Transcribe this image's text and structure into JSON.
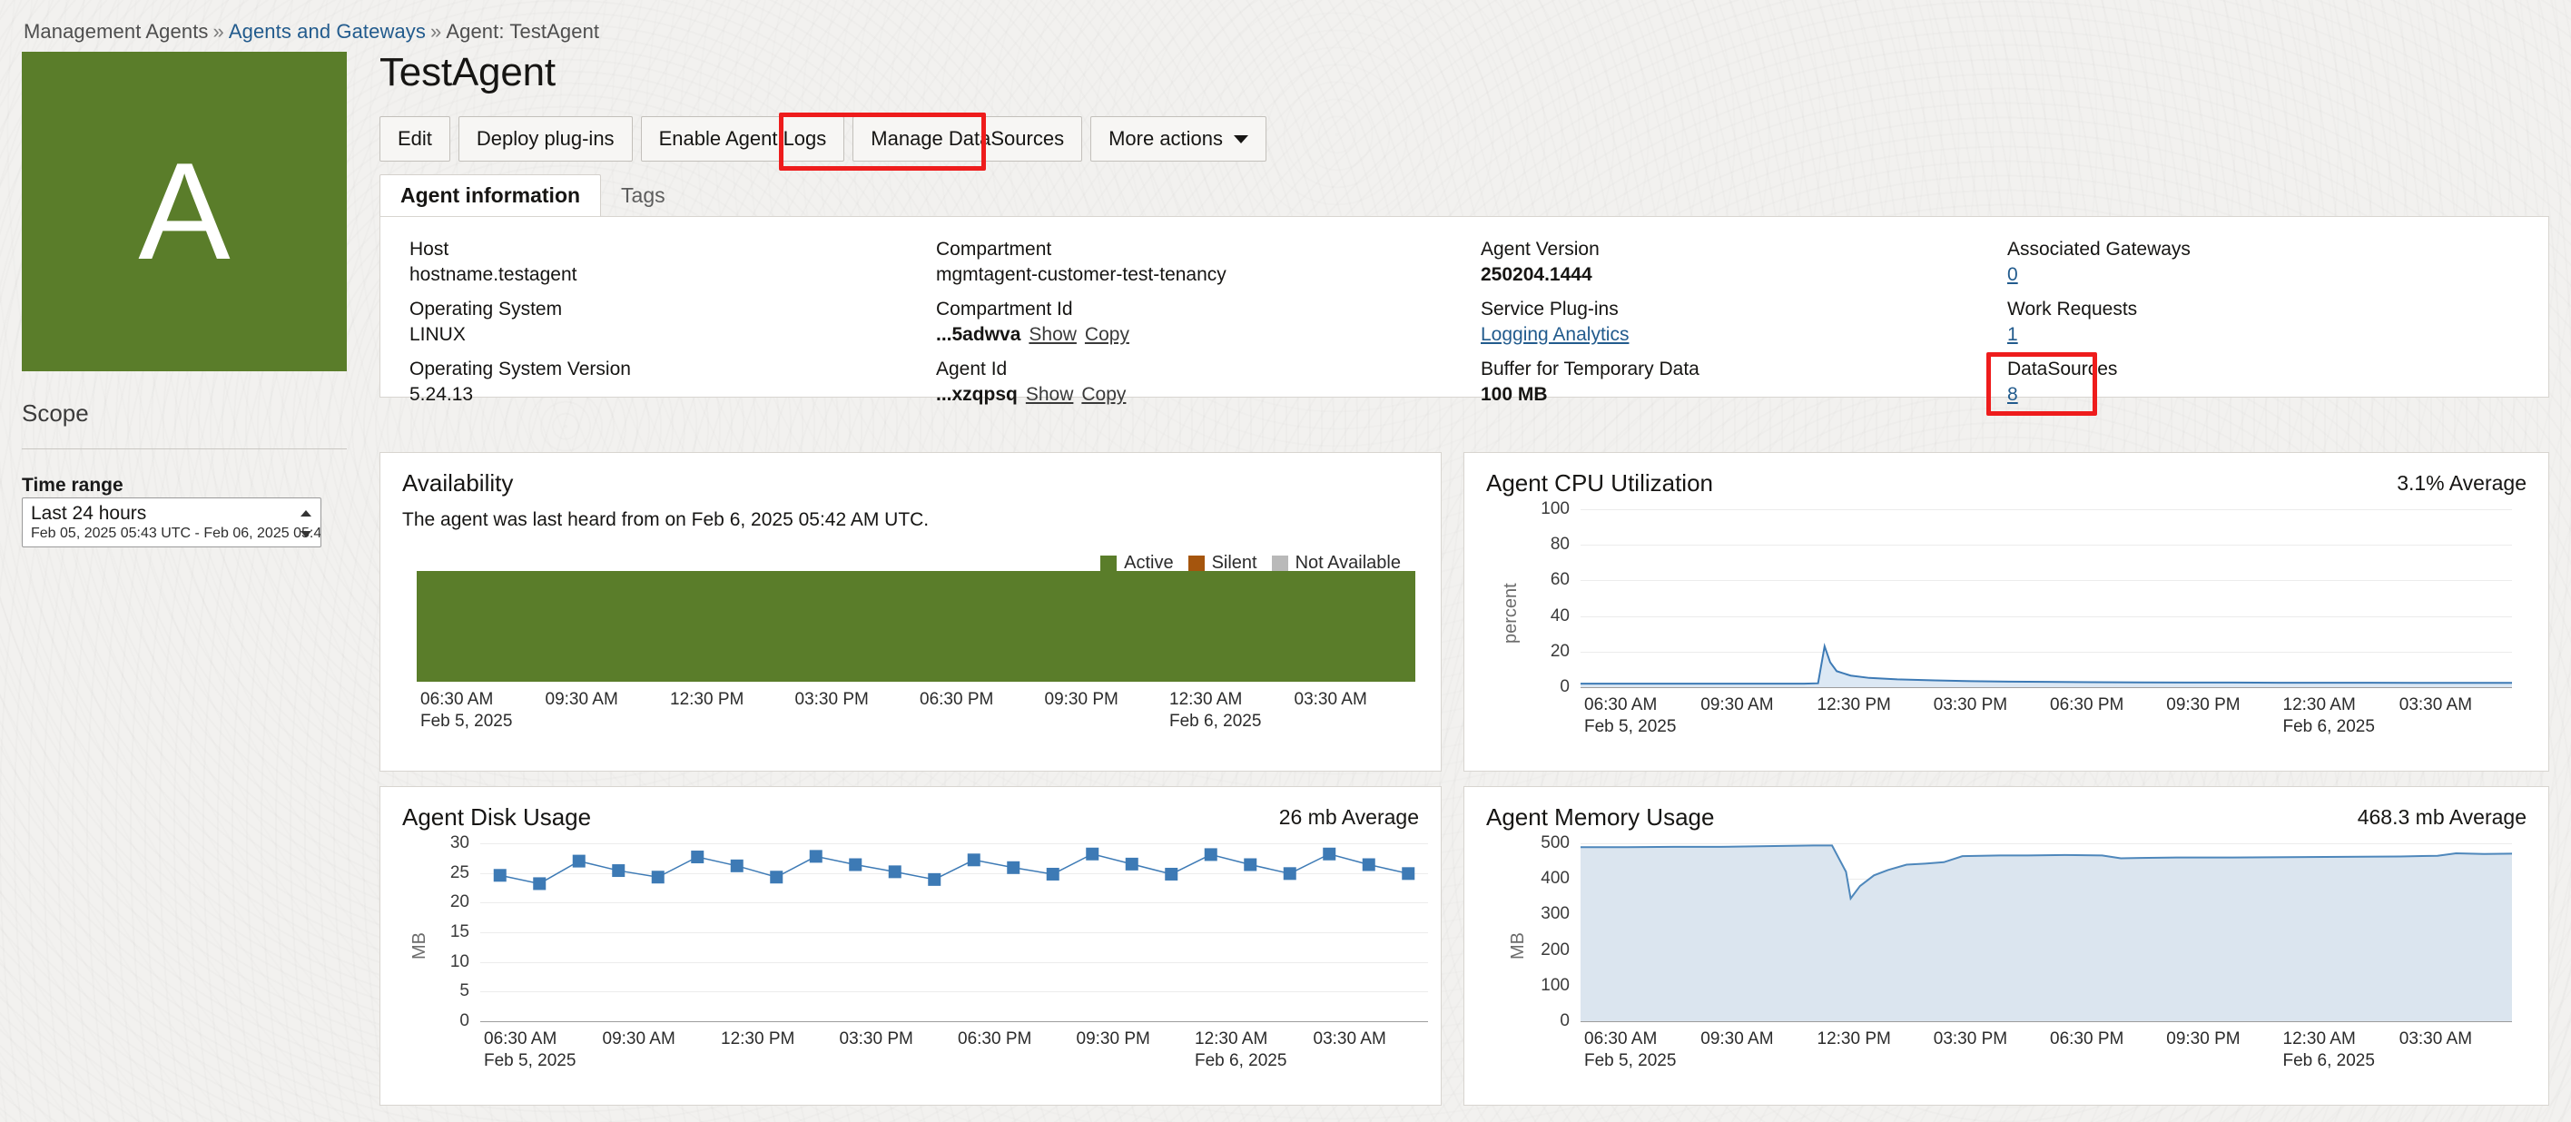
{
  "breadcrumb": {
    "root": "Management Agents",
    "sep": "»",
    "link": "Agents and Gateways",
    "current": "Agent: TestAgent"
  },
  "avatar": {
    "letter": "A"
  },
  "header": {
    "title": "TestAgent"
  },
  "actions": [
    {
      "label": "Edit",
      "name": "edit-button",
      "caret": false
    },
    {
      "label": "Deploy plug-ins",
      "name": "deploy-plugins-button",
      "caret": false
    },
    {
      "label": "Enable Agent Logs",
      "name": "enable-agent-logs-button",
      "caret": false
    },
    {
      "label": "Manage DataSources",
      "name": "manage-datasources-button",
      "caret": false
    },
    {
      "label": "More actions",
      "name": "more-actions-button",
      "caret": true
    }
  ],
  "tabs": [
    {
      "label": "Agent information",
      "active": true
    },
    {
      "label": "Tags",
      "active": false
    }
  ],
  "scope": {
    "title": "Scope",
    "time_range_label": "Time range",
    "time_range_value": "Last 24 hours",
    "time_range_detail": "Feb 05, 2025 05:43 UTC - Feb 06, 2025 05:4"
  },
  "info": {
    "col1": [
      {
        "key": "Host",
        "value": "hostname.testagent",
        "bold": false
      },
      {
        "key": "Operating System",
        "value": "LINUX",
        "bold": false
      },
      {
        "key": "Operating System Version",
        "value": "5.24.13",
        "bold": false
      }
    ],
    "col2": [
      {
        "key": "Compartment",
        "value": "mgmtagent-customer-test-tenancy",
        "bold": false
      },
      {
        "key": "Compartment Id",
        "value": "...5adwva",
        "bold": true,
        "show": "Show",
        "copy": "Copy"
      },
      {
        "key": "Agent Id",
        "value": "...xzqpsq",
        "bold": true,
        "show": "Show",
        "copy": "Copy"
      }
    ],
    "col3": [
      {
        "key": "Agent Version",
        "value": "250204.1444",
        "bold": true
      },
      {
        "key": "Service Plug-ins",
        "value": "Logging Analytics",
        "link": true
      },
      {
        "key": "Buffer for Temporary Data",
        "value": "100 MB",
        "bold": true
      }
    ],
    "col4": [
      {
        "key": "Associated Gateways",
        "value": "0",
        "link": true
      },
      {
        "key": "Work Requests",
        "value": "1",
        "link": true
      },
      {
        "key": "DataSources",
        "value": "8",
        "link": true
      }
    ]
  },
  "highlights": {
    "color": "#ee1c1c",
    "targets": [
      "manage-datasources-button",
      "datasources-field"
    ]
  },
  "charts": {
    "availability": {
      "title": "Availability",
      "note": "The agent was last heard from on Feb 6, 2025 05:42 AM UTC."
    },
    "cpu": {
      "title": "Agent CPU Utilization",
      "metric": "3.1% Average"
    },
    "disk": {
      "title": "Agent Disk Usage",
      "metric": "26 mb Average"
    },
    "memory": {
      "title": "Agent Memory Usage",
      "metric": "468.3 mb Average"
    }
  },
  "chart_data": [
    {
      "id": "availability",
      "type": "bar",
      "title": "Availability",
      "annotation": "The agent was last heard from on Feb 6, 2025 05:42 AM UTC.",
      "legend": [
        {
          "label": "Active",
          "color": "#5a7d2a"
        },
        {
          "label": "Silent",
          "color": "#a5550d"
        },
        {
          "label": "Not Available",
          "color": "#b9b9b9"
        }
      ],
      "legend_position": "top-right",
      "categories": [
        "06:30 AM\nFeb 5, 2025",
        "09:30 AM",
        "12:30 PM",
        "03:30 PM",
        "06:30 PM",
        "09:30 PM",
        "12:30 AM\nFeb 6, 2025",
        "03:30 AM"
      ],
      "xlabel": "",
      "ylabel": "",
      "grid": false,
      "series": [
        {
          "name": "Active",
          "color": "#5a7d2a",
          "spans": [
            {
              "start": 0.0,
              "end": 1.0,
              "state": "Active"
            }
          ]
        }
      ]
    },
    {
      "id": "cpu",
      "type": "area",
      "title": "Agent CPU Utilization",
      "subtitle": "3.1% Average",
      "ylabel": "percent",
      "xlabel": "",
      "ylim": [
        0,
        100
      ],
      "yticks": [
        0,
        20,
        40,
        60,
        80,
        100
      ],
      "grid": true,
      "xticks": [
        "06:30 AM\nFeb 5, 2025",
        "09:30 AM",
        "12:30 PM",
        "03:30 PM",
        "06:30 PM",
        "09:30 PM",
        "12:30 AM\nFeb 6, 2025",
        "03:30 AM"
      ],
      "line_color": "#3d7ab5",
      "fill_color": "#dce8f4",
      "series": [
        {
          "name": "percent",
          "x": [
            0,
            0.04,
            0.08,
            0.12,
            0.16,
            0.2,
            0.24,
            0.255,
            0.262,
            0.268,
            0.275,
            0.29,
            0.31,
            0.34,
            0.38,
            0.42,
            0.46,
            0.5,
            0.55,
            0.6,
            0.65,
            0.7,
            0.75,
            0.8,
            0.85,
            0.9,
            0.95,
            1.0
          ],
          "values": [
            2.0,
            2.0,
            2.0,
            2.0,
            2.0,
            2.0,
            2.0,
            2.2,
            23.0,
            14.0,
            9.0,
            6.5,
            5.2,
            4.4,
            3.8,
            3.4,
            3.1,
            3.0,
            2.8,
            2.7,
            2.6,
            2.6,
            2.5,
            2.5,
            2.5,
            2.4,
            2.4,
            2.4
          ]
        }
      ]
    },
    {
      "id": "disk",
      "type": "line",
      "title": "Agent Disk Usage",
      "subtitle": "26 mb Average",
      "ylabel": "MB",
      "xlabel": "",
      "ylim": [
        0,
        30
      ],
      "yticks": [
        0,
        5,
        10,
        15,
        20,
        25,
        30
      ],
      "grid": true,
      "markers": true,
      "marker_color": "#3d7ab5",
      "line_color": "#3d7ab5",
      "xticks": [
        "06:30 AM\nFeb 5, 2025",
        "09:30 AM",
        "12:30 PM",
        "03:30 PM",
        "06:30 PM",
        "09:30 PM",
        "12:30 AM\nFeb 6, 2025",
        "03:30 AM"
      ],
      "series": [
        {
          "name": "MB",
          "values": [
            24.6,
            23.2,
            27.0,
            25.4,
            24.3,
            27.7,
            26.2,
            24.3,
            27.8,
            26.4,
            25.2,
            23.9,
            27.2,
            25.9,
            24.8,
            28.2,
            26.5,
            24.8,
            28.1,
            26.4,
            24.9,
            28.2,
            26.4,
            24.9
          ]
        }
      ]
    },
    {
      "id": "memory",
      "type": "area",
      "title": "Agent Memory Usage",
      "subtitle": "468.3 mb Average",
      "ylabel": "MB",
      "xlabel": "",
      "ylim": [
        0,
        500
      ],
      "yticks": [
        0,
        100,
        200,
        300,
        400,
        500
      ],
      "grid": true,
      "line_color": "#4e87bb",
      "fill_color": "#dbe5ef",
      "xticks": [
        "06:30 AM\nFeb 5, 2025",
        "09:30 AM",
        "12:30 PM",
        "03:30 PM",
        "06:30 PM",
        "09:30 PM",
        "12:30 AM\nFeb 6, 2025",
        "03:30 AM"
      ],
      "series": [
        {
          "name": "MB",
          "x": [
            0,
            0.05,
            0.1,
            0.15,
            0.2,
            0.25,
            0.27,
            0.285,
            0.29,
            0.3,
            0.315,
            0.33,
            0.35,
            0.37,
            0.39,
            0.41,
            0.43,
            0.45,
            0.48,
            0.52,
            0.56,
            0.58,
            0.6,
            0.64,
            0.7,
            0.76,
            0.82,
            0.88,
            0.92,
            0.94,
            0.97,
            1.0
          ],
          "values": [
            489,
            489,
            490,
            490,
            492,
            494,
            494,
            420,
            345,
            380,
            410,
            425,
            440,
            443,
            447,
            464,
            465,
            466,
            466,
            467,
            466,
            458,
            459,
            460,
            460,
            461,
            462,
            463,
            465,
            472,
            470,
            471
          ]
        }
      ]
    }
  ]
}
